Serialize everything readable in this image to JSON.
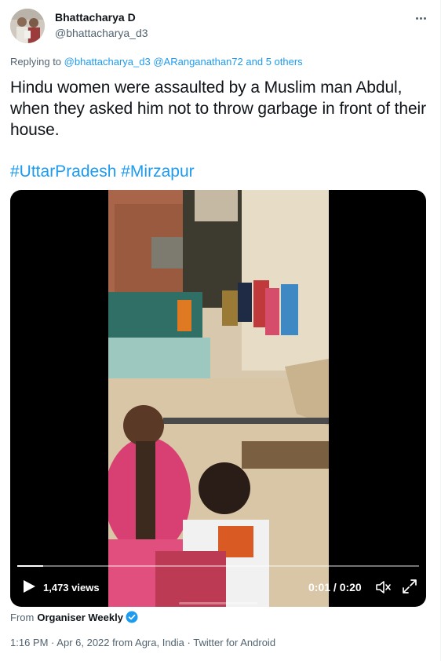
{
  "author": {
    "name": "Bhattacharya D",
    "handle": "@bhattacharya_d3"
  },
  "reply": {
    "prefix": "Replying to",
    "mention_1": "@bhattacharya_d3",
    "mention_2": "@ARanganathan72",
    "others": "and 5 others"
  },
  "tweet": {
    "text": "Hindu women were assaulted by a Muslim man Abdul, when they asked him not to throw garbage in front of their house.",
    "hashtag_1": "#UttarPradesh",
    "hashtag_2": "#Mirzapur"
  },
  "video": {
    "views": "1,473 views",
    "time": "0:01 / 0:20",
    "progress": 0.065
  },
  "source": {
    "prefix": "From",
    "name": "Organiser Weekly"
  },
  "meta": {
    "time": "1:16 PM",
    "date": "Apr 6, 2022",
    "location": "from Agra, India",
    "client": "Twitter for Android",
    "separator": "·"
  },
  "colors": {
    "accent": "#1d9bf0",
    "text": "#0f1419",
    "secondary": "#536471"
  }
}
